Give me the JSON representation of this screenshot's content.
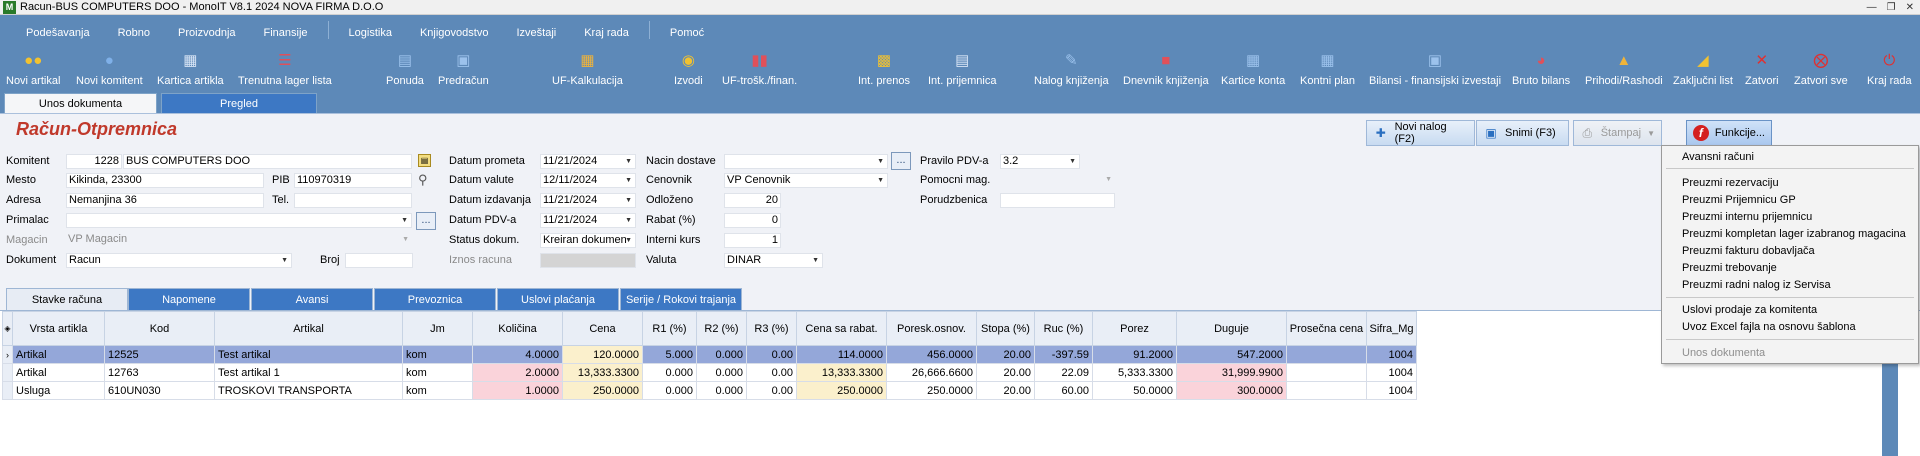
{
  "window": {
    "title": "Racun-BUS COMPUTERS DOO - MonoIT V8.1 2024 NOVA FIRMA D.O.O",
    "app_icon_letter": "M"
  },
  "menu": {
    "items": [
      "Podešavanja",
      "Robno",
      "Proizvodnja",
      "Finansije",
      "Logistika",
      "Knjigovodstvo",
      "Izveštaji",
      "Kraj rada",
      "Pomoć"
    ]
  },
  "toolbar": {
    "buttons": [
      {
        "label": "Novi artikal",
        "icon": "users-add-icon"
      },
      {
        "label": "Novi komitent",
        "icon": "person-add-icon"
      },
      {
        "label": "Kartica artikla",
        "icon": "card-icon"
      },
      {
        "label": "Trenutna lager lista",
        "icon": "list-icon"
      },
      {
        "label": "Ponuda",
        "icon": "offer-icon"
      },
      {
        "label": "Predračun",
        "icon": "invoice-icon"
      },
      {
        "label": "UF-Kalkulacija",
        "icon": "grid-icon"
      },
      {
        "label": "Izvodi",
        "icon": "statement-icon"
      },
      {
        "label": "UF-trošk./finan.",
        "icon": "chart-icon"
      },
      {
        "label": "Int. prenos",
        "icon": "transfer-icon"
      },
      {
        "label": "Int. prijemnica",
        "icon": "receipt-icon"
      },
      {
        "label": "Nalog knjiženja",
        "icon": "journal-icon"
      },
      {
        "label": "Dnevnik knjiženja",
        "icon": "book-icon"
      },
      {
        "label": "Kartice konta",
        "icon": "account-card-icon"
      },
      {
        "label": "Kontni plan",
        "icon": "plan-icon"
      },
      {
        "label": "Bilansi - finansijski izvestaji",
        "icon": "balance-icon"
      },
      {
        "label": "Bruto bilans",
        "icon": "pie-icon"
      },
      {
        "label": "Prihodi/Rashodi",
        "icon": "income-chart-icon"
      },
      {
        "label": "Zaključni list",
        "icon": "final-sheet-icon"
      },
      {
        "label": "Zatvori",
        "icon": "close-icon"
      },
      {
        "label": "Zatvori sve",
        "icon": "close-all-icon"
      },
      {
        "label": "Kraj rada",
        "icon": "power-icon"
      }
    ]
  },
  "top_tabs": [
    "Unos dokumenta",
    "Pregled"
  ],
  "doc_title": "Račun-Otpremnica",
  "actions": {
    "new": "Novi nalog (F2)",
    "save": "Snimi (F3)",
    "print": "Štampaj",
    "functions": "Funkcije..."
  },
  "form": {
    "komitent_label": "Komitent",
    "komitent_code": "1228",
    "komitent_name": "BUS COMPUTERS DOO",
    "mesto_label": "Mesto",
    "mesto": "Kikinda, 23300",
    "pib_label": "PIB",
    "pib": "110970319",
    "adresa_label": "Adresa",
    "adresa": "Nemanjina 36",
    "tel_label": "Tel.",
    "tel": "",
    "primalac_label": "Primalac",
    "primalac": "",
    "magacin_label": "Magacin",
    "magacin": "VP Magacin",
    "dokument_label": "Dokument",
    "dokument": "Racun",
    "broj_label": "Broj",
    "broj": "",
    "datum_prometa_label": "Datum prometa",
    "datum_prometa": "11/21/2024",
    "datum_valute_label": "Datum valute",
    "datum_valute": "12/11/2024",
    "datum_izdavanja_label": "Datum izdavanja",
    "datum_izdavanja": "11/21/2024",
    "datum_pdv_label": "Datum PDV-a",
    "datum_pdv": "11/21/2024",
    "status_label": "Status dokum.",
    "status": "Kreiran dokumen",
    "iznos_label": "Iznos racuna",
    "iznos": "",
    "nacin_dostave_label": "Nacin dostave",
    "nacin_dostave": "",
    "cenovnik_label": "Cenovnik",
    "cenovnik": "VP Cenovnik",
    "odlozeno_label": "Odloženo",
    "odlozeno": "20",
    "rabat_label": "Rabat (%)",
    "rabat": "0",
    "interni_kurs_label": "Interni kurs",
    "interni_kurs": "1",
    "valuta_label": "Valuta",
    "valuta": "DINAR",
    "pravilo_pdv_label": "Pravilo PDV-a",
    "pravilo_pdv": "3.2",
    "pomocni_mag_label": "Pomocni mag.",
    "pomocni_mag": "",
    "porudzbenica_label": "Porudzbenica",
    "porudzbenica": ""
  },
  "bottom_tabs": [
    "Stavke računa",
    "Napomene",
    "Avansi",
    "Prevoznica",
    "Uslovi plaćanja",
    "Serije / Rokovi trajanja"
  ],
  "grid": {
    "columns": [
      "Vrsta artikla",
      "Kod",
      "Artikal",
      "Jm",
      "Količina",
      "Cena",
      "R1 (%)",
      "R2 (%)",
      "R3 (%)",
      "Cena sa rabat.",
      "Poresk.osnov.",
      "Stopa (%)",
      "Ruc (%)",
      "Porez",
      "Duguje",
      "Prosečna cena",
      "Sifra_Mg"
    ],
    "rows": [
      [
        "Artikal",
        "12525",
        "Test artikal",
        "kom",
        "4.0000",
        "120.0000",
        "5.000",
        "0.000",
        "0.00",
        "114.0000",
        "456.0000",
        "20.00",
        "-397.59",
        "91.2000",
        "547.2000",
        "",
        "1004"
      ],
      [
        "Artikal",
        "12763",
        "Test artikal 1",
        "kom",
        "2.0000",
        "13,333.3300",
        "0.000",
        "0.000",
        "0.00",
        "13,333.3300",
        "26,666.6600",
        "20.00",
        "22.09",
        "5,333.3300",
        "31,999.9900",
        "",
        "1004"
      ],
      [
        "Usluga",
        "610UN030",
        "TROSKOVI TRANSPORTA",
        "kom",
        "1.0000",
        "250.0000",
        "0.000",
        "0.000",
        "0.00",
        "250.0000",
        "250.0000",
        "20.00",
        "60.00",
        "50.0000",
        "300.0000",
        "",
        "1004"
      ]
    ],
    "selected_row_marker": "›"
  },
  "functions_menu": {
    "items": [
      "Avansni računi",
      "Preuzmi rezervaciju",
      "Preuzmi Prijemnicu GP",
      "Preuzmi internu prijemnicu",
      "Preuzmi kompletan lager izabranog magacina",
      "Preuzmi fakturu dobavljača",
      "Preuzmi trebovanje",
      "Preuzmi radni nalog iz Servisa",
      "Uslovi prodaje za komitenta",
      "Uvoz Excel fajla na osnovu šablona",
      "Unos dokumenta"
    ]
  },
  "colors": {
    "menu_bg": "#5d89b8",
    "title_red": "#c0392b",
    "selected_row": "#94a7d9",
    "pink_cell": "#fad3da",
    "yellow_cell": "#fbf0cc"
  }
}
